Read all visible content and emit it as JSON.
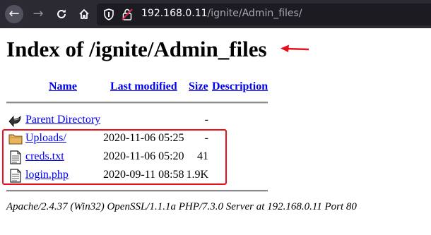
{
  "browser": {
    "url_host": "192.168.0.11",
    "url_path": "/ignite/Admin_files/"
  },
  "page": {
    "title": "Index of /ignite/Admin_files",
    "columns": {
      "name": "Name",
      "last_modified": "Last modified",
      "size": "Size",
      "description": "Description"
    },
    "parent": {
      "name": "Parent Directory",
      "size": "-"
    },
    "entries": [
      {
        "name": "Uploads/",
        "modified": "2020-11-06 05:25",
        "size": "-",
        "icon": "folder-icon"
      },
      {
        "name": "creds.txt",
        "modified": "2020-11-06 05:20",
        "size": "41",
        "icon": "text-file-icon"
      },
      {
        "name": "login.php",
        "modified": "2020-09-11 08:58",
        "size": "1.9K",
        "icon": "text-file-icon"
      }
    ],
    "footer": "Apache/2.4.37 (Win32) OpenSSL/1.1.1a PHP/7.3.0 Server at 192.168.0.11 Port 80"
  },
  "annotations": {
    "color": "#e8101d"
  }
}
